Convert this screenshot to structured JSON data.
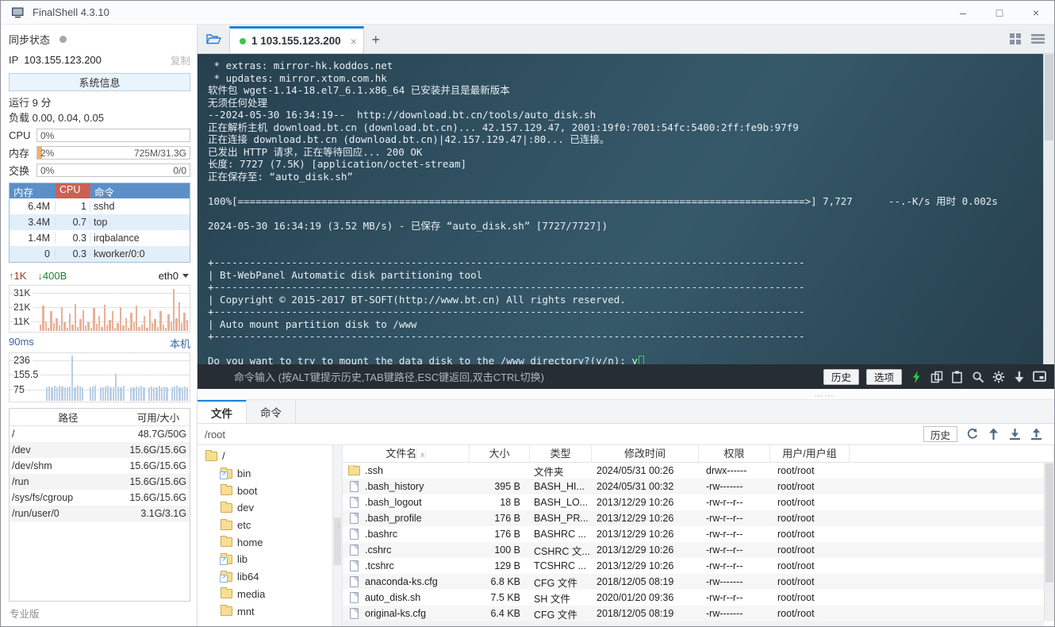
{
  "window": {
    "title": "FinalShell 4.3.10",
    "controls": {
      "minimize": "–",
      "maximize": "□",
      "close": "×"
    }
  },
  "sidebar": {
    "sync_label": "同步状态",
    "ip_label": "IP",
    "ip": "103.155.123.200",
    "copy_label": "复制",
    "sysinfo_button": "系统信息",
    "uptime": "运行 9 分",
    "load": "负载 0.00, 0.04, 0.05",
    "meters": {
      "cpu": {
        "label": "CPU",
        "value": "0%",
        "right": "",
        "fill": 0
      },
      "mem": {
        "label": "内存",
        "value": "2%",
        "right": "725M/31.3G",
        "fill": 3
      },
      "swap": {
        "label": "交换",
        "value": "0%",
        "right": "0/0",
        "fill": 0
      }
    },
    "process_table": {
      "headers": {
        "mem": "内存",
        "cpu": "CPU",
        "cmd": "命令"
      },
      "header_colors": {
        "mem": "#5a8fc8",
        "cpu": "#cb6155",
        "cmd": "#5a8fc8"
      },
      "rows": [
        {
          "mem": "6.4M",
          "cpu": "1",
          "cmd": "sshd"
        },
        {
          "mem": "3.4M",
          "cpu": "0.7",
          "cmd": "top"
        },
        {
          "mem": "1.4M",
          "cpu": "0.3",
          "cmd": "irqbalance"
        },
        {
          "mem": "0",
          "cpu": "0.3",
          "cmd": "kworker/0:0"
        }
      ]
    },
    "network": {
      "up": "1K",
      "down": "400B",
      "iface": "eth0",
      "yticks": [
        "31K",
        "21K",
        "11K"
      ],
      "bar_color": "#eab097",
      "values": [
        14,
        58,
        22,
        8,
        46,
        18,
        30,
        12,
        55,
        20,
        8,
        40,
        15,
        62,
        10,
        28,
        48,
        12,
        20,
        8,
        52,
        16,
        35,
        10,
        60,
        14,
        25,
        45,
        8,
        18,
        55,
        12,
        30,
        8,
        42,
        20,
        58,
        10,
        15,
        35,
        8,
        50,
        18,
        28,
        10,
        45,
        15,
        8,
        38,
        20,
        97,
        30,
        65,
        18,
        42,
        25
      ]
    },
    "ping": {
      "label": "90ms",
      "host": "本机",
      "yticks": [
        "236",
        "155.5",
        "75"
      ],
      "bar_color": "#b9cfe6",
      "values": [
        30,
        31,
        29,
        32,
        30,
        33,
        31,
        30,
        29,
        31,
        98,
        30,
        32,
        31,
        29,
        0,
        0,
        30,
        31,
        32,
        0,
        29,
        30,
        31,
        33,
        30,
        29,
        58,
        31,
        30,
        32,
        0,
        0,
        29,
        30,
        31,
        30,
        32,
        29,
        0,
        30,
        31,
        29,
        30,
        32,
        30,
        31,
        29,
        0,
        30,
        31,
        32,
        30,
        29,
        31,
        30
      ]
    },
    "disk_table": {
      "headers": {
        "path": "路径",
        "size": "可用/大小"
      },
      "rows": [
        {
          "path": "/",
          "size": "48.7G/50G"
        },
        {
          "path": "/dev",
          "size": "15.6G/15.6G"
        },
        {
          "path": "/dev/shm",
          "size": "15.6G/15.6G"
        },
        {
          "path": "/run",
          "size": "15.6G/15.6G"
        },
        {
          "path": "/sys/fs/cgroup",
          "size": "15.6G/15.6G"
        },
        {
          "path": "/run/user/0",
          "size": "3.1G/3.1G"
        }
      ]
    },
    "edition": "专业版"
  },
  "tabbar": {
    "tab_label": "1 103.155.123.200",
    "tab_close": "×",
    "new_tab": "+"
  },
  "terminal": {
    "output": " * extras: mirror-hk.koddos.net\n * updates: mirror.xtom.com.hk\n软件包 wget-1.14-18.el7_6.1.x86_64 已安装并且是最新版本\n无须任何处理\n--2024-05-30 16:34:19--  http://download.bt.cn/tools/auto_disk.sh\n正在解析主机 download.bt.cn (download.bt.cn)... 42.157.129.47, 2001:19f0:7001:54fc:5400:2ff:fe9b:97f9\n正在连接 download.bt.cn (download.bt.cn)|42.157.129.47|:80... 已连接。\n已发出 HTTP 请求，正在等待回应... 200 OK\n长度: 7727 (7.5K) [application/octet-stream]\n正在保存至: “auto_disk.sh”\n\n100%[===============================================================================================>] 7,727      --.-K/s 用时 0.002s\n\n2024-05-30 16:34:19 (3.52 MB/s) - 已保存 “auto_disk.sh” [7727/7727])\n\n\n+---------------------------------------------------------------------------------------------------\n| Bt-WebPanel Automatic disk partitioning tool\n+---------------------------------------------------------------------------------------------------\n| Copyright © 2015-2017 BT-SOFT(http://www.bt.cn) All rights reserved.\n+---------------------------------------------------------------------------------------------------\n| Auto mount partition disk to /www\n+---------------------------------------------------------------------------------------------------",
    "prompt": "Do you want to try to mount the data disk to the /www directory?(y/n): y",
    "input_placeholder": "命令输入 (按ALT键提示历史,TAB键路径,ESC键返回,双击CTRL切换)",
    "history_button": "历史",
    "options_button": "选项"
  },
  "bottom_panel": {
    "tabs": {
      "files": "文件",
      "commands": "命令"
    },
    "path": "/root",
    "history_button": "历史",
    "tree": [
      {
        "name": "/",
        "depth": 0,
        "link": false
      },
      {
        "name": "bin",
        "depth": 1,
        "link": true
      },
      {
        "name": "boot",
        "depth": 1,
        "link": false
      },
      {
        "name": "dev",
        "depth": 1,
        "link": false
      },
      {
        "name": "etc",
        "depth": 1,
        "link": false
      },
      {
        "name": "home",
        "depth": 1,
        "link": false
      },
      {
        "name": "lib",
        "depth": 1,
        "link": true
      },
      {
        "name": "lib64",
        "depth": 1,
        "link": true
      },
      {
        "name": "media",
        "depth": 1,
        "link": false
      },
      {
        "name": "mnt",
        "depth": 1,
        "link": false
      }
    ],
    "file_table": {
      "headers": [
        "文件名",
        "大小",
        "类型",
        "修改时间",
        "权限",
        "用户/用户组"
      ],
      "rows": [
        {
          "name": ".ssh",
          "icon": "folder",
          "size": "",
          "type": "文件夹",
          "mtime": "2024/05/31 00:26",
          "perm": "drwx------",
          "owner": "root/root"
        },
        {
          "name": ".bash_history",
          "icon": "file",
          "size": "395 B",
          "type": "BASH_HI...",
          "mtime": "2024/05/31 00:32",
          "perm": "-rw-------",
          "owner": "root/root"
        },
        {
          "name": ".bash_logout",
          "icon": "file",
          "size": "18 B",
          "type": "BASH_LO...",
          "mtime": "2013/12/29 10:26",
          "perm": "-rw-r--r--",
          "owner": "root/root"
        },
        {
          "name": ".bash_profile",
          "icon": "file",
          "size": "176 B",
          "type": "BASH_PR...",
          "mtime": "2013/12/29 10:26",
          "perm": "-rw-r--r--",
          "owner": "root/root"
        },
        {
          "name": ".bashrc",
          "icon": "file",
          "size": "176 B",
          "type": "BASHRC ...",
          "mtime": "2013/12/29 10:26",
          "perm": "-rw-r--r--",
          "owner": "root/root"
        },
        {
          "name": ".cshrc",
          "icon": "file",
          "size": "100 B",
          "type": "CSHRC 文...",
          "mtime": "2013/12/29 10:26",
          "perm": "-rw-r--r--",
          "owner": "root/root"
        },
        {
          "name": ".tcshrc",
          "icon": "file",
          "size": "129 B",
          "type": "TCSHRC ...",
          "mtime": "2013/12/29 10:26",
          "perm": "-rw-r--r--",
          "owner": "root/root"
        },
        {
          "name": "anaconda-ks.cfg",
          "icon": "file",
          "size": "6.8 KB",
          "type": "CFG 文件",
          "mtime": "2018/12/05 08:19",
          "perm": "-rw-------",
          "owner": "root/root"
        },
        {
          "name": "auto_disk.sh",
          "icon": "file",
          "size": "7.5 KB",
          "type": "SH 文件",
          "mtime": "2020/01/20 09:36",
          "perm": "-rw-r--r--",
          "owner": "root/root"
        },
        {
          "name": "original-ks.cfg",
          "icon": "file",
          "size": "6.4 KB",
          "type": "CFG 文件",
          "mtime": "2018/12/05 08:19",
          "perm": "-rw-------",
          "owner": "root/root"
        }
      ]
    }
  }
}
